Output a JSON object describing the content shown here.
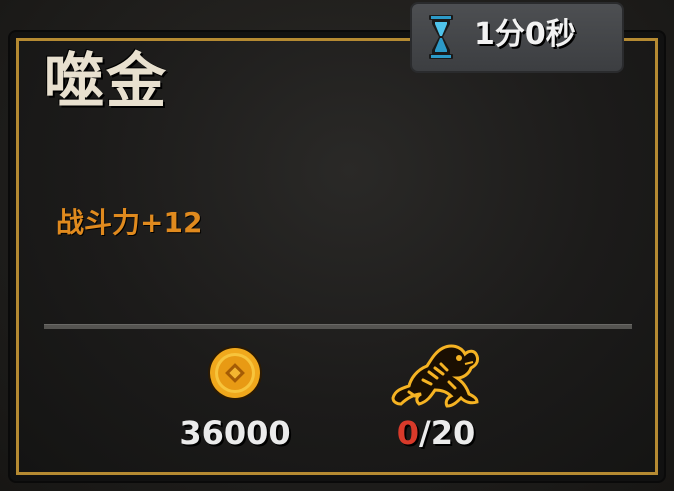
{
  "timer": {
    "text": "1分0秒",
    "icon": "hourglass-icon"
  },
  "item": {
    "title": "噬金",
    "effect": "战斗力+12"
  },
  "costs": {
    "coin": {
      "icon": "gold-coin-icon",
      "amount": "36000"
    },
    "tiger": {
      "icon": "tiger-icon",
      "have": "0",
      "need": "/20"
    }
  },
  "colors": {
    "frame": "#b58a32",
    "effect": "#e08a1e",
    "insufficient": "#d83a2a"
  }
}
